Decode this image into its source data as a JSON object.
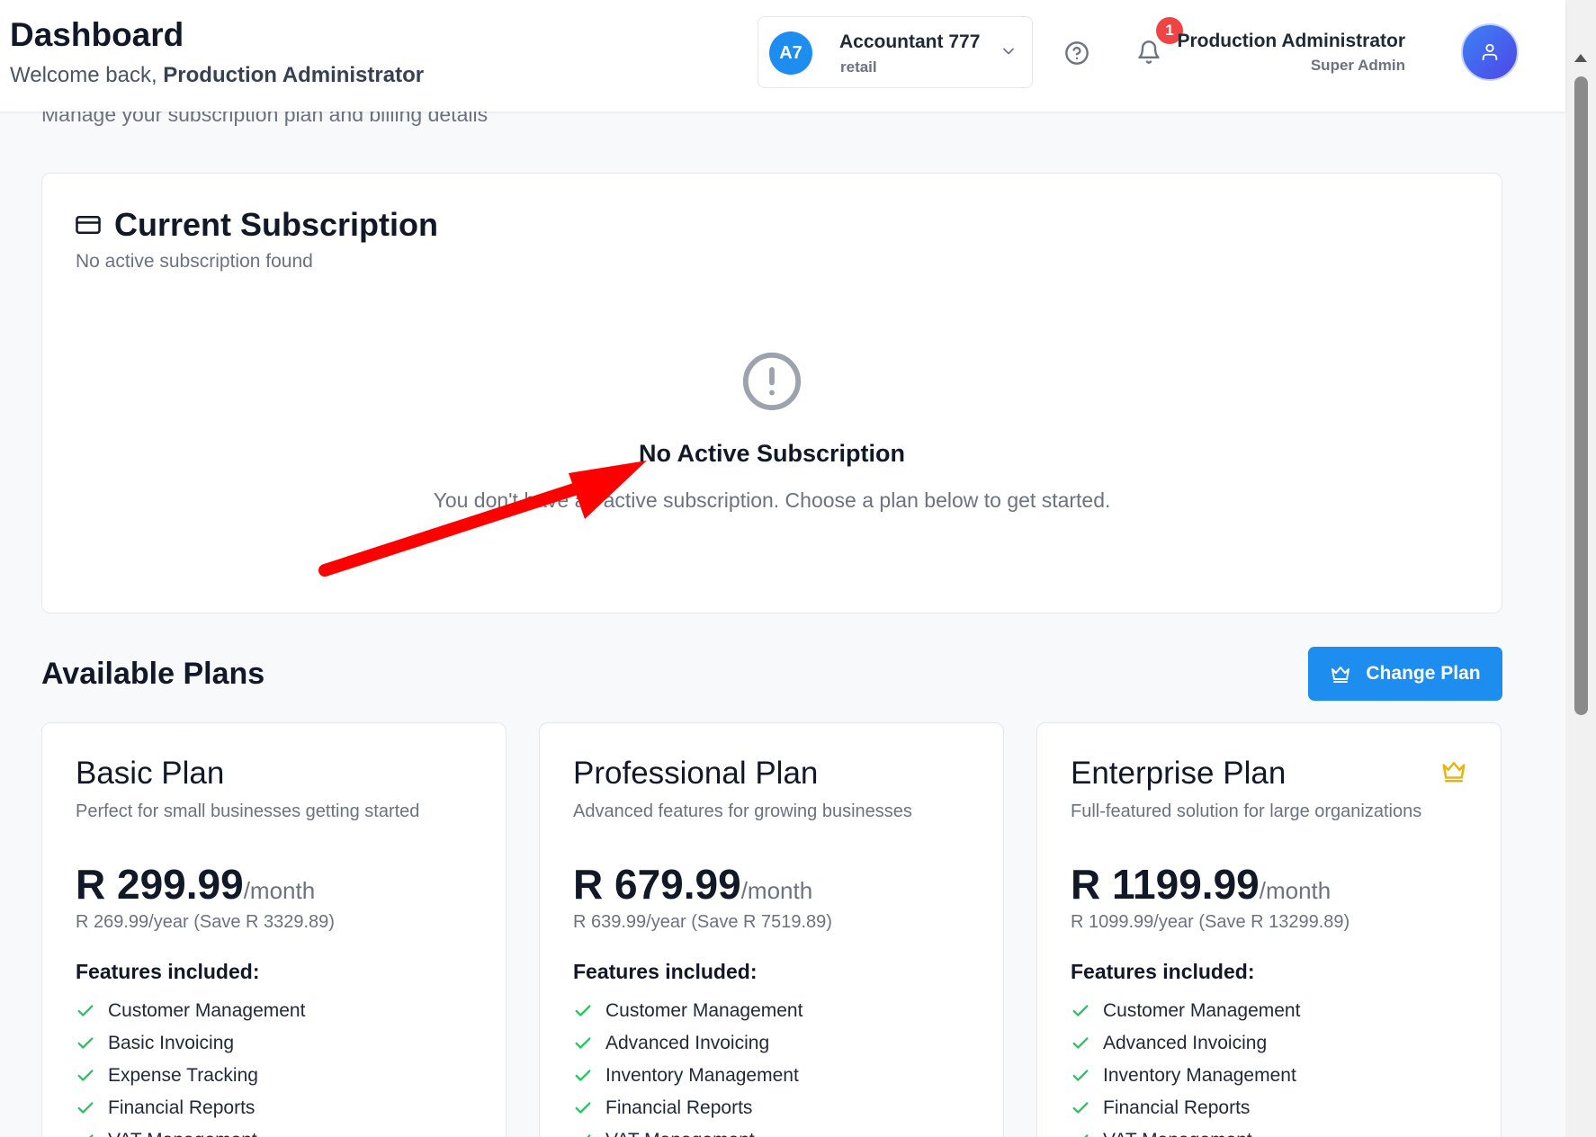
{
  "header": {
    "title": "Dashboard",
    "welcome_prefix": "Welcome back,",
    "welcome_name": "Production Administrator",
    "org": {
      "initials": "A7",
      "name": "Accountant 777",
      "type": "retail"
    },
    "notification_count": "1",
    "user": {
      "name": "Production Administrator",
      "role": "Super Admin"
    }
  },
  "page": {
    "subtitle": "Manage your subscription plan and billing details"
  },
  "current_subscription": {
    "title": "Current Subscription",
    "subtitle": "No active subscription found",
    "empty_title": "No Active Subscription",
    "empty_text": "You don't have an active subscription. Choose a plan below to get started."
  },
  "plans_section": {
    "title": "Available Plans",
    "change_button": "Change Plan"
  },
  "plans": [
    {
      "name": "Basic Plan",
      "description": "Perfect for small businesses getting started",
      "price": "R 299.99",
      "period": "/month",
      "yearly": "R 269.99/year (Save R 3329.89)",
      "features_heading": "Features included:",
      "features": [
        "Customer Management",
        "Basic Invoicing",
        "Expense Tracking",
        "Financial Reports",
        "VAT Management"
      ]
    },
    {
      "name": "Professional Plan",
      "description": "Advanced features for growing businesses",
      "price": "R 679.99",
      "period": "/month",
      "yearly": "R 639.99/year (Save R 7519.89)",
      "features_heading": "Features included:",
      "features": [
        "Customer Management",
        "Advanced Invoicing",
        "Inventory Management",
        "Financial Reports",
        "VAT Management"
      ]
    },
    {
      "name": "Enterprise Plan",
      "description": "Full-featured solution for large organizations",
      "price": "R 1199.99",
      "period": "/month",
      "yearly": "R 1099.99/year (Save R 13299.89)",
      "features_heading": "Features included:",
      "features": [
        "Customer Management",
        "Advanced Invoicing",
        "Inventory Management",
        "Financial Reports",
        "VAT Management"
      ]
    }
  ],
  "colors": {
    "primary": "#1e8df0",
    "success": "#22c55e",
    "badge": "#ef4444",
    "crown": "#eab308",
    "annotation": "#ff0000"
  },
  "icons": [
    "chevron-down-icon",
    "help-circle-icon",
    "bell-icon",
    "user-icon",
    "credit-card-icon",
    "alert-circle-icon",
    "crown-icon",
    "check-icon"
  ]
}
